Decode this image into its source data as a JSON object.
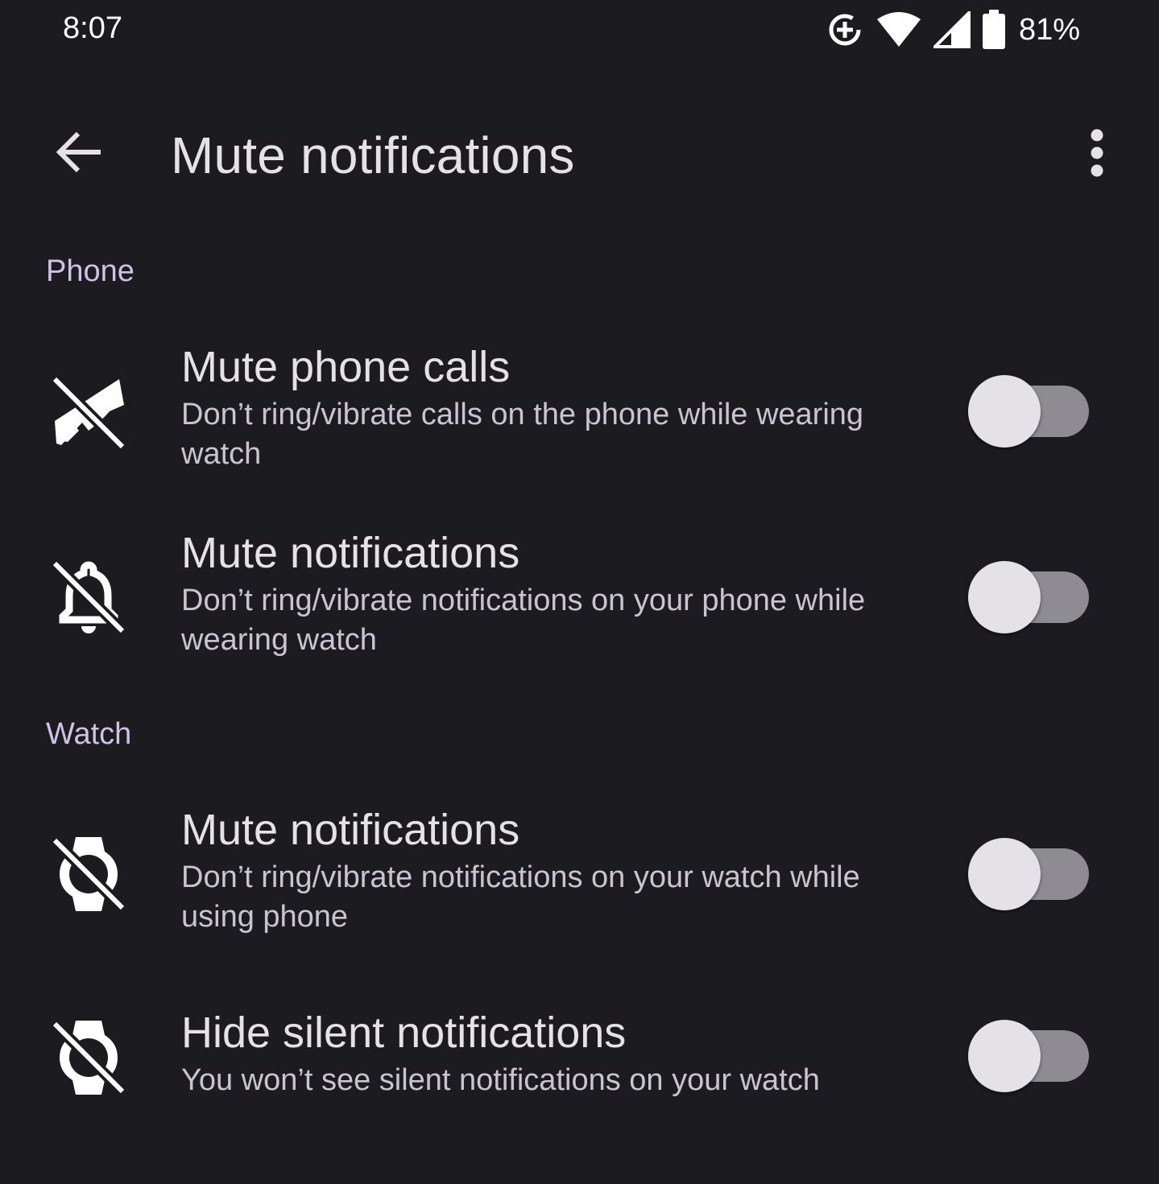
{
  "status_bar": {
    "time": "8:07",
    "battery_percent": "81%",
    "icons": [
      "data-saver-icon",
      "wifi-icon",
      "cell-signal-icon",
      "battery-icon"
    ]
  },
  "app_bar": {
    "title": "Mute notifications",
    "back_icon": "arrow-back-icon",
    "overflow_icon": "more-vert-icon"
  },
  "sections": [
    {
      "header": "Phone",
      "items": [
        {
          "title": "Mute phone calls",
          "summary": "Don’t ring/vibrate calls on the phone while wearing watch",
          "icon": "phone-disabled-icon",
          "enabled": false
        },
        {
          "title": "Mute notifications",
          "summary": "Don’t ring/vibrate notifications on your phone while wearing watch",
          "icon": "notifications-off-icon",
          "enabled": false
        }
      ]
    },
    {
      "header": "Watch",
      "items": [
        {
          "title": "Mute notifications",
          "summary": "Don’t ring/vibrate notifications on your watch while using phone",
          "icon": "watch-off-icon",
          "enabled": false
        },
        {
          "title": "Hide silent notifications",
          "summary": "You won’t see silent notifications on your watch",
          "icon": "watch-off-icon",
          "enabled": false
        }
      ]
    }
  ],
  "colors": {
    "background": "#1c1b1f",
    "switch_track_off": "#8e8c92",
    "switch_thumb_off": "#e4e2e6",
    "section_header": "#cfc2e6"
  }
}
